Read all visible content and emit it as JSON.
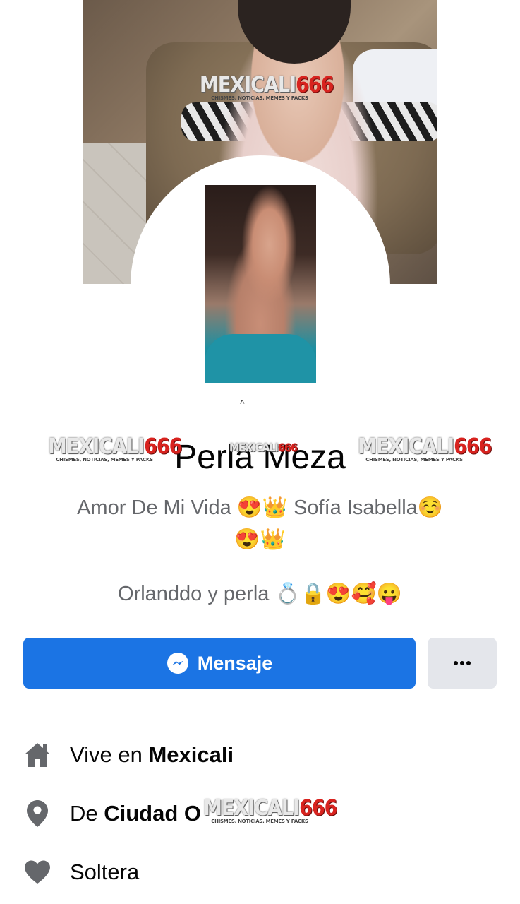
{
  "watermark": {
    "brand_left": "MEXICALI",
    "brand_right": "666",
    "tagline": "CHISMES, NOTICIAS, MEMES Y PACKS"
  },
  "profile": {
    "name": "Perla Meza",
    "bio_line1": "Amor De Mi Vida 😍👑 Sofía Isabella☺️",
    "bio_line2": "😍👑",
    "bio_line3": "Orlanddo y perla 💍🔒😍🥰😛",
    "small_glyph": "^"
  },
  "actions": {
    "message_label": "Mensaje",
    "more_label": "•••"
  },
  "details": {
    "lives_prefix": "Vive en ",
    "lives_place": "Mexicali",
    "from_prefix": "De ",
    "from_place": "Ciudad O",
    "relationship": "Soltera"
  },
  "colors": {
    "primary": "#1b74e4",
    "secondary_bg": "#e4e6eb",
    "icon_gray": "#65676b",
    "brand_red": "#d8231f"
  },
  "icons": {
    "messenger": "messenger-icon",
    "more": "more-icon",
    "home": "home-icon",
    "location": "location-pin-icon",
    "relationship": "heart-icon"
  }
}
